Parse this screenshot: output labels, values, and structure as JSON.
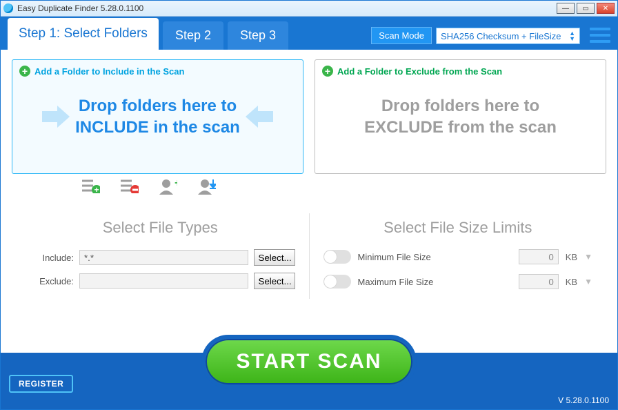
{
  "window": {
    "title": "Easy Duplicate Finder 5.28.0.1100"
  },
  "tabs": {
    "step1": "Step 1: Select Folders",
    "step2": "Step 2",
    "step3": "Step 3"
  },
  "scanMode": {
    "label": "Scan Mode",
    "value": "SHA256 Checksum + FileSize"
  },
  "include": {
    "addLabel": "Add a Folder to Include in the Scan",
    "hint1": "Drop folders here to",
    "hint2": "INCLUDE in the scan"
  },
  "exclude": {
    "addLabel": "Add a Folder to Exclude from the Scan",
    "hint1": "Drop folders here to",
    "hint2": "EXCLUDE from the scan"
  },
  "fileTypes": {
    "title": "Select File Types",
    "includeLabel": "Include:",
    "includeValue": "*.*",
    "excludeLabel": "Exclude:",
    "excludeValue": "",
    "selectBtn": "Select..."
  },
  "fileSize": {
    "title": "Select File Size Limits",
    "minLabel": "Minimum File Size",
    "minValue": "0",
    "maxLabel": "Maximum File Size",
    "maxValue": "0",
    "unit": "KB"
  },
  "footer": {
    "register": "REGISTER",
    "startScan": "START  SCAN",
    "version": "V 5.28.0.1100"
  }
}
